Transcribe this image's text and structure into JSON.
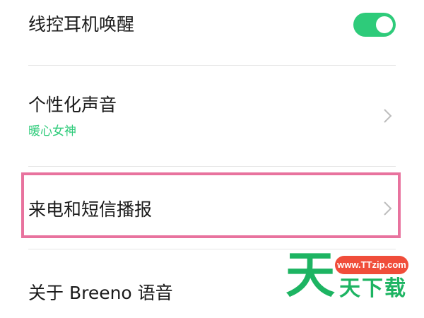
{
  "settings": {
    "items": [
      {
        "title": "线控耳机唤醒",
        "toggle_on": true
      },
      {
        "title": "个性化声音",
        "subtitle": "暖心女神"
      },
      {
        "title": "来电和短信播报"
      },
      {
        "title": "关于 Breeno 语音"
      }
    ]
  },
  "watermark": {
    "big_char": "天",
    "url": "www.TTzip.com",
    "text": "天下载"
  },
  "colors": {
    "accent": "#2ecb7a",
    "highlight_border": "#e8739e",
    "watermark_green": "#1db462",
    "watermark_red": "#f04d3a"
  }
}
